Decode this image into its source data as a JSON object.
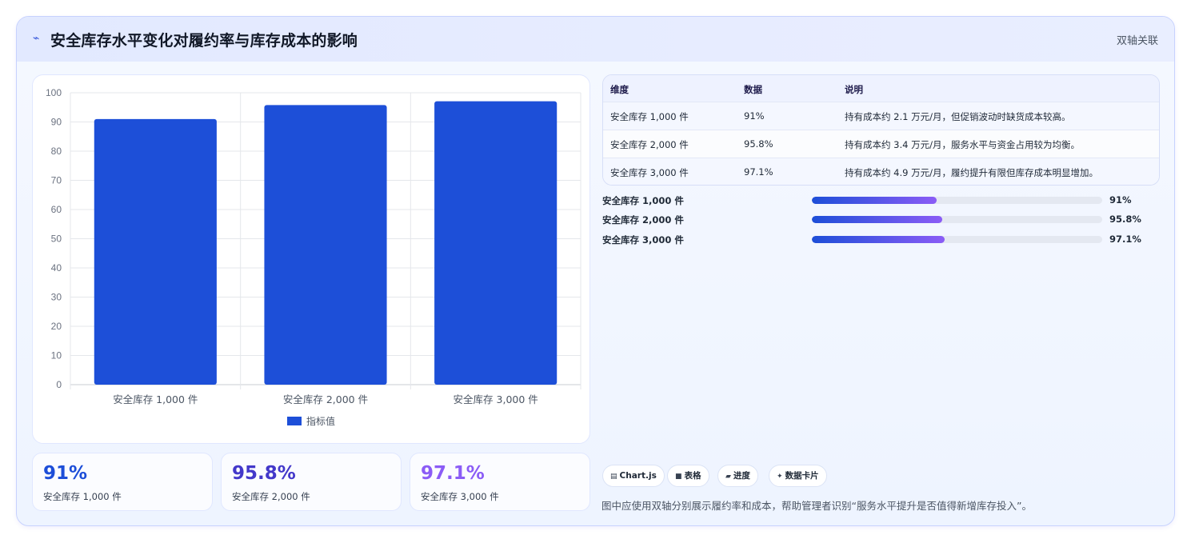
{
  "header": {
    "icon": "chart-trend-icon",
    "title": "安全库存水平变化对履约率与库存成本的影响",
    "tag": "双轴关联"
  },
  "chart_data": {
    "type": "bar",
    "categories": [
      "安全库存 1,000 件",
      "安全库存 2,000 件",
      "安全库存 3,000 件"
    ],
    "series": [
      {
        "name": "指标值",
        "values": [
          91,
          95.8,
          97.1
        ],
        "color": "#1d4fd8"
      }
    ],
    "ylim": [
      0,
      100
    ],
    "yticks": [
      0,
      10,
      20,
      30,
      40,
      50,
      60,
      70,
      80,
      90,
      100
    ],
    "grid": true,
    "legend": "bottom"
  },
  "kpis": [
    {
      "value": "91%",
      "label": "安全库存 1,000 件",
      "color": "#1d4ed8"
    },
    {
      "value": "95.8%",
      "label": "安全库存 2,000 件",
      "color": "#4338ca"
    },
    {
      "value": "97.1%",
      "label": "安全库存 3,000 件",
      "color": "#8b5cf6"
    }
  ],
  "table": {
    "headers": [
      "维度",
      "数据",
      "说明"
    ],
    "rows": [
      [
        "安全库存 1,000 件",
        "91%",
        "持有成本约 2.1 万元/月，但促销波动时缺货成本较高。"
      ],
      [
        "安全库存 2,000 件",
        "95.8%",
        "持有成本约 3.4 万元/月，服务水平与资金占用较为均衡。"
      ],
      [
        "安全库存 3,000 件",
        "97.1%",
        "持有成本约 4.9 万元/月，履约提升有限但库存成本明显增加。"
      ]
    ]
  },
  "progress": [
    {
      "label": "安全库存 1,000 件",
      "value_text": "91%",
      "fraction": 0.43
    },
    {
      "label": "安全库存 2,000 件",
      "value_text": "95.8%",
      "fraction": 0.45
    },
    {
      "label": "安全库存 3,000 件",
      "value_text": "97.1%",
      "fraction": 0.457
    }
  ],
  "pills": [
    {
      "icon": "chart-icon",
      "glyph": "▤",
      "label": "Chart.js"
    },
    {
      "icon": "table-icon",
      "glyph": "■",
      "label": "表格"
    },
    {
      "icon": "progress-icon",
      "glyph": "▰",
      "label": "进度"
    },
    {
      "icon": "sparkle-icon",
      "glyph": "✦",
      "label": "数据卡片"
    }
  ],
  "footnote": "图中应使用双轴分别展示履约率和成本，帮助管理者识别“服务水平提升是否值得新增库存投入”。"
}
